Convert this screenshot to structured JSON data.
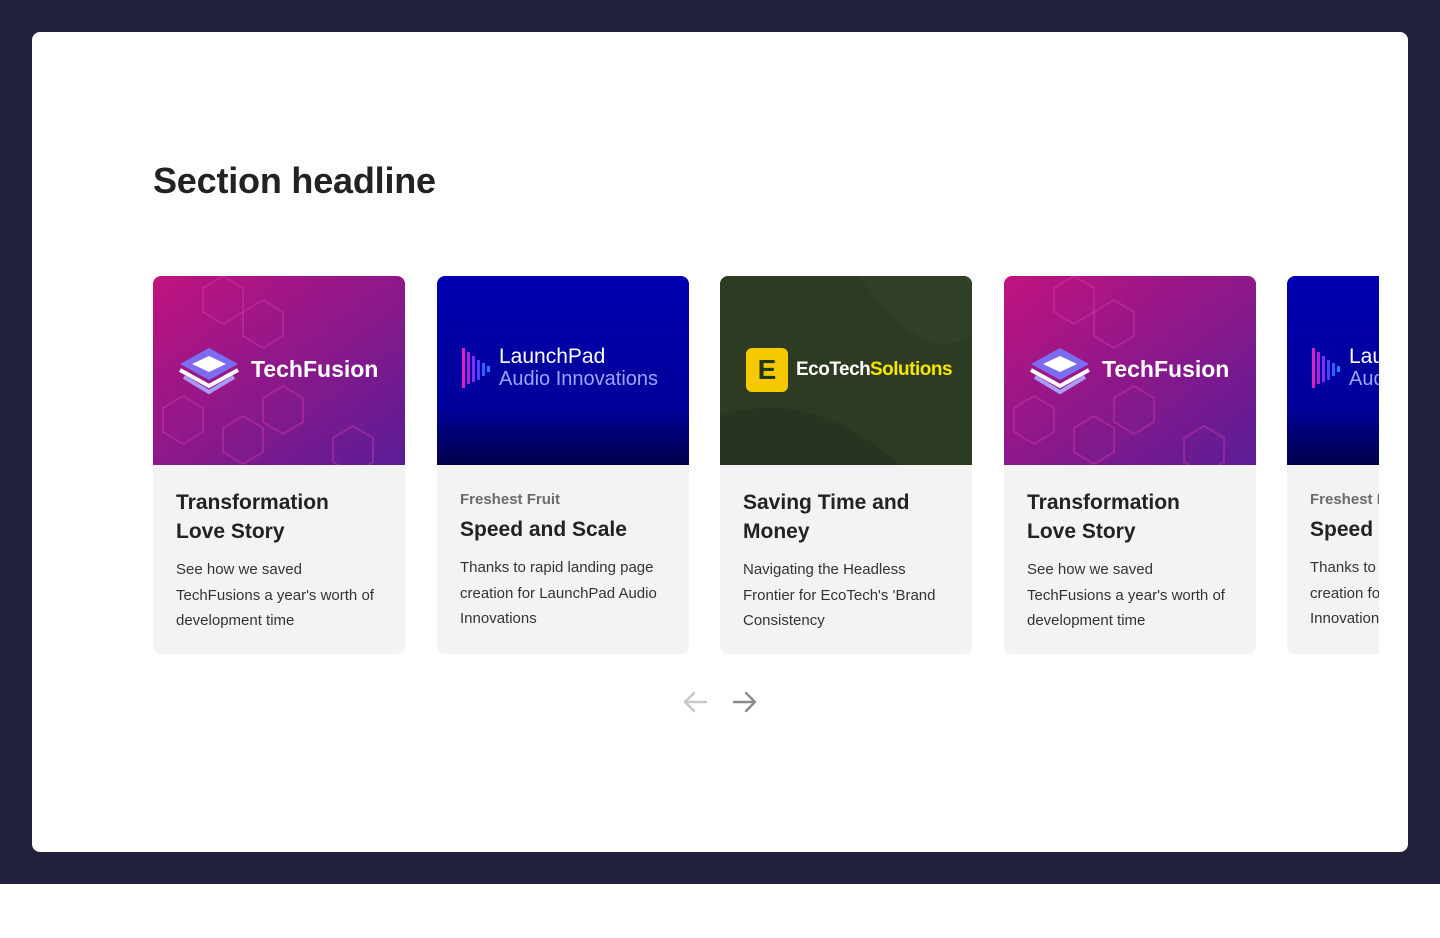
{
  "section": {
    "headline": "Section headline"
  },
  "cards": [
    {
      "logo": {
        "name": "TechFusion"
      },
      "eyebrow": "",
      "title": "Transformation Love Story",
      "description": "See how we saved TechFusions a year's worth of development time"
    },
    {
      "logo": {
        "line1": "LaunchPad",
        "line2": "Audio Innovations"
      },
      "eyebrow": "Freshest Fruit",
      "title": "Speed and Scale",
      "description": "Thanks to rapid landing page creation for LaunchPad Audio Innovations"
    },
    {
      "logo": {
        "part1": "EcoTech",
        "part2": "Solutions",
        "mark": "E"
      },
      "eyebrow": "",
      "title": "Saving Time and Money",
      "description": "Navigating the Headless Frontier for EcoTech's 'Brand Consistency"
    },
    {
      "logo": {
        "name": "TechFusion"
      },
      "eyebrow": "",
      "title": "Transformation Love Story",
      "description": "See how we saved TechFusions a year's worth of development time"
    },
    {
      "logo": {
        "line1": "LaunchPad",
        "line2": "Audio Innovations"
      },
      "eyebrow": "Freshest Fruit",
      "title": "Speed and Scale",
      "description": "Thanks to rapid landing page creation for LaunchPad Audio Innovations"
    }
  ],
  "carousel_nav": {
    "prev_icon": "arrow-left-icon",
    "next_icon": "arrow-right-icon",
    "prev_disabled": true
  },
  "colors": {
    "backdrop": "#20203d",
    "card_bg": "#f3f3f3",
    "techfusion_start": "#c0137e",
    "techfusion_end": "#5a1d96",
    "launchpad_top": "#0000b0",
    "launchpad_bottom": "#00006a",
    "ecotech_bg": "#2d3b22",
    "ecotech_accent": "#f5e600"
  }
}
